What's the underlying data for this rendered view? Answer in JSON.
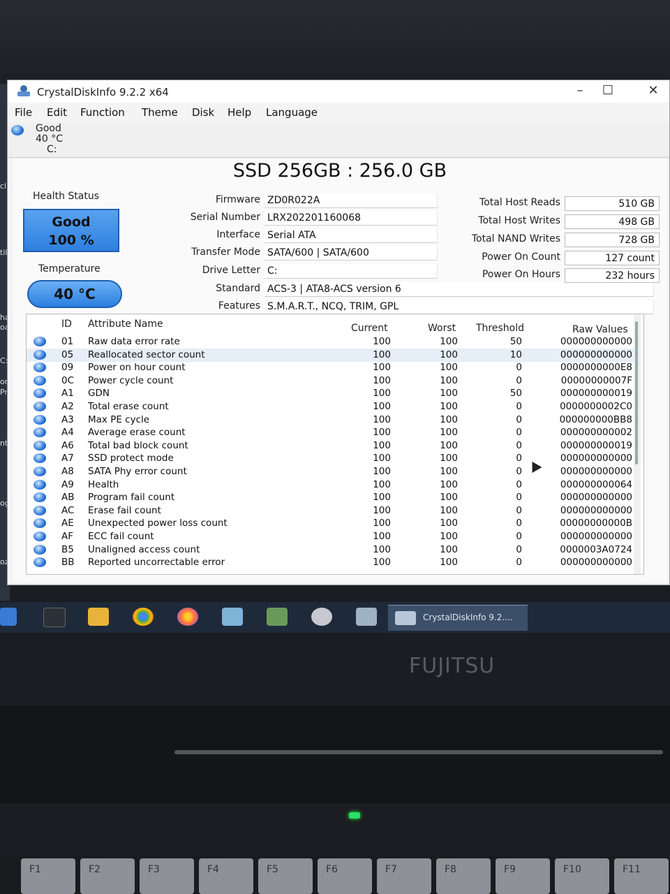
{
  "window": {
    "title": "CrystalDiskInfo 9.2.2 x64"
  },
  "menu": [
    "File",
    "Edit",
    "Function",
    "Theme",
    "Disk",
    "Help",
    "Language"
  ],
  "disk_tab": {
    "status": "Good",
    "temp": "40 °C",
    "drive": "C:"
  },
  "model": "SSD 256GB : 256.0 GB",
  "health": {
    "label": "Health Status",
    "status": "Good",
    "percent": "100 %"
  },
  "temperature": {
    "label": "Temperature",
    "value": "40 °C"
  },
  "info_left": [
    {
      "label": "Firmware",
      "value": "ZD0R022A"
    },
    {
      "label": "Serial Number",
      "value": "LRX202201160068"
    },
    {
      "label": "Interface",
      "value": "Serial ATA"
    },
    {
      "label": "Transfer Mode",
      "value": "SATA/600 | SATA/600"
    },
    {
      "label": "Drive Letter",
      "value": "C:"
    }
  ],
  "standard": {
    "label": "Standard",
    "value": "ACS-3 | ATA8-ACS version 6"
  },
  "features": {
    "label": "Features",
    "value": "S.M.A.R.T., NCQ, TRIM, GPL"
  },
  "info_right": [
    {
      "label": "Total Host Reads",
      "value": "510 GB"
    },
    {
      "label": "Total Host Writes",
      "value": "498 GB"
    },
    {
      "label": "Total NAND Writes",
      "value": "728 GB"
    },
    {
      "label": "Power On Count",
      "value": "127 count"
    },
    {
      "label": "Power On Hours",
      "value": "232 hours"
    }
  ],
  "smart_headers": [
    "ID",
    "Attribute Name",
    "Current",
    "Worst",
    "Threshold",
    "Raw Values"
  ],
  "smart_rows": [
    [
      "01",
      "Raw data error rate",
      "100",
      "100",
      "50",
      "000000000000"
    ],
    [
      "05",
      "Reallocated sector count",
      "100",
      "100",
      "10",
      "000000000000"
    ],
    [
      "09",
      "Power on hour count",
      "100",
      "100",
      "0",
      "0000000000E8"
    ],
    [
      "0C",
      "Power cycle count",
      "100",
      "100",
      "0",
      "00000000007F"
    ],
    [
      "A1",
      "GDN",
      "100",
      "100",
      "50",
      "000000000019"
    ],
    [
      "A2",
      "Total erase count",
      "100",
      "100",
      "0",
      "0000000002C0"
    ],
    [
      "A3",
      "Max PE cycle",
      "100",
      "100",
      "0",
      "000000000BB8"
    ],
    [
      "A4",
      "Average erase count",
      "100",
      "100",
      "0",
      "000000000002"
    ],
    [
      "A6",
      "Total bad block count",
      "100",
      "100",
      "0",
      "000000000019"
    ],
    [
      "A7",
      "SSD protect mode",
      "100",
      "100",
      "0",
      "000000000000"
    ],
    [
      "A8",
      "SATA Phy error count",
      "100",
      "100",
      "0",
      "000000000000"
    ],
    [
      "A9",
      "Health",
      "100",
      "100",
      "0",
      "000000000064"
    ],
    [
      "AB",
      "Program fail count",
      "100",
      "100",
      "0",
      "000000000000"
    ],
    [
      "AC",
      "Erase fail count",
      "100",
      "100",
      "0",
      "000000000000"
    ],
    [
      "AE",
      "Unexpected power loss count",
      "100",
      "100",
      "0",
      "00000000000B"
    ],
    [
      "AF",
      "ECC fail count",
      "100",
      "100",
      "0",
      "000000000000"
    ],
    [
      "B5",
      "Unaligned access count",
      "100",
      "100",
      "0",
      "0000003A0724"
    ],
    [
      "BB",
      "Reported uncorrectable error",
      "100",
      "100",
      "0",
      "000000000000"
    ]
  ],
  "taskbar": {
    "active_label": "CrystalDiskInfo 9.2...."
  },
  "desktop_snippets": [
    "cl",
    "tilit",
    "har",
    "oard",
    "C:\\",
    "omm",
    "Prom",
    "ntrol",
    "ogle C",
    "ozilla F"
  ],
  "brand": "FUJITSU",
  "fkeys": [
    "F1",
    "F2",
    "F3",
    "F4",
    "F5",
    "F6",
    "F7",
    "F8",
    "F9",
    "F10",
    "F11"
  ],
  "colors": {
    "health_blue": "#2d7fe0",
    "taskbar": "#1e2a3a",
    "led_green": "#27e06a"
  }
}
